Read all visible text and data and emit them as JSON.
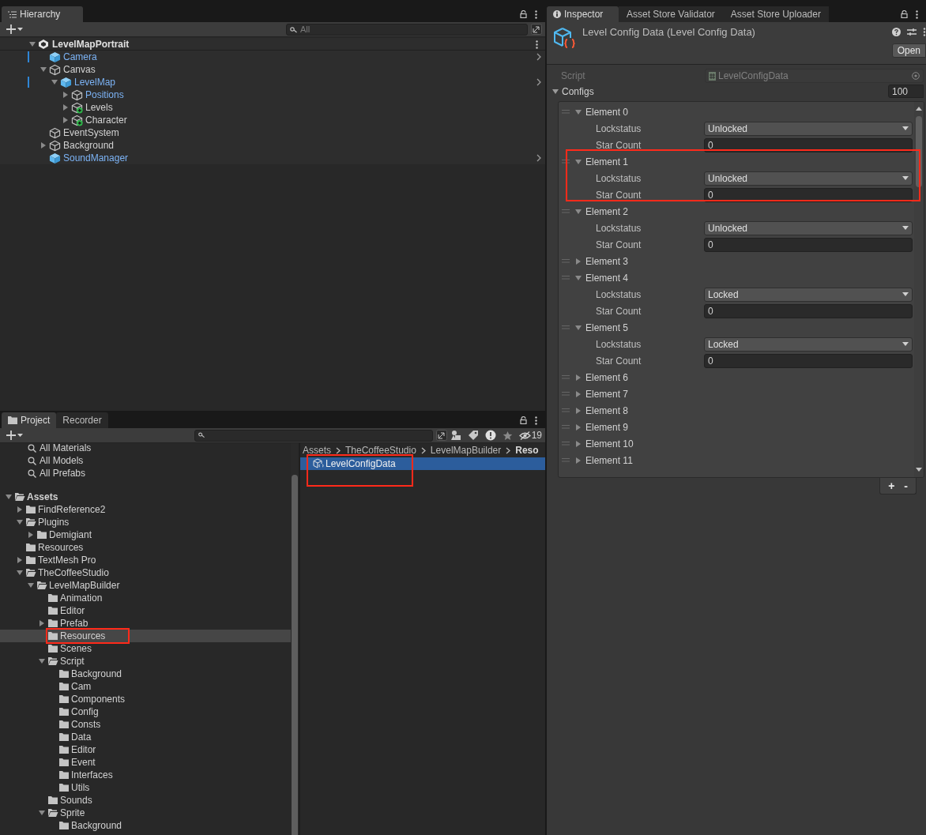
{
  "hierarchy": {
    "tab": {
      "label": "Hierarchy",
      "selected": true
    },
    "search": {
      "placeholder": "All"
    },
    "scene": {
      "name": "LevelMapPortrait",
      "expanded": true,
      "children": [
        {
          "name": "Camera",
          "kind": "prefab",
          "modified": true,
          "prefab_arrow": true
        },
        {
          "name": "Canvas",
          "kind": "object",
          "expanded": true,
          "children": [
            {
              "name": "LevelMap",
              "kind": "prefab",
              "modified": true,
              "prefab_arrow": true,
              "expanded": true,
              "children": [
                {
                  "name": "Positions",
                  "kind": "object",
                  "linked": true,
                  "expanded": false
                },
                {
                  "name": "Levels",
                  "kind": "added",
                  "expanded": false
                },
                {
                  "name": "Character",
                  "kind": "added",
                  "expanded": false
                }
              ]
            }
          ]
        },
        {
          "name": "EventSystem",
          "kind": "object"
        },
        {
          "name": "Background",
          "kind": "object",
          "expanded": false
        },
        {
          "name": "SoundManager",
          "kind": "prefab",
          "prefab_arrow": true
        }
      ]
    }
  },
  "project": {
    "tabs": [
      {
        "label": "Project",
        "selected": true
      },
      {
        "label": "Recorder",
        "selected": false
      }
    ],
    "hidden_count": "19",
    "favorites": [
      "All Materials",
      "All Models",
      "All Prefabs"
    ],
    "tree": {
      "name": "Assets",
      "expanded": true,
      "selected": false,
      "children": [
        {
          "name": "FindReference2",
          "expanded": false,
          "selected": false
        },
        {
          "name": "Plugins",
          "expanded": true,
          "selected": false,
          "children": [
            {
              "name": "Demigiant",
              "expanded": false,
              "selected": false
            }
          ]
        },
        {
          "name": "Resources",
          "selected": false
        },
        {
          "name": "TextMesh Pro",
          "expanded": false,
          "selected": false
        },
        {
          "name": "TheCoffeeStudio",
          "expanded": true,
          "selected": false,
          "children": [
            {
              "name": "LevelMapBuilder",
              "expanded": true,
              "selected": false,
              "children": [
                {
                  "name": "Animation",
                  "selected": false
                },
                {
                  "name": "Editor",
                  "selected": false
                },
                {
                  "name": "Prefab",
                  "expanded": false,
                  "selected": false
                },
                {
                  "name": "Resources",
                  "selected": true,
                  "highlighted": true
                },
                {
                  "name": "Scenes",
                  "selected": false
                },
                {
                  "name": "Script",
                  "expanded": true,
                  "selected": false,
                  "children": [
                    {
                      "name": "Background",
                      "selected": false
                    },
                    {
                      "name": "Cam",
                      "selected": false
                    },
                    {
                      "name": "Components",
                      "selected": false
                    },
                    {
                      "name": "Config",
                      "selected": false
                    },
                    {
                      "name": "Consts",
                      "selected": false
                    },
                    {
                      "name": "Data",
                      "selected": false
                    },
                    {
                      "name": "Editor",
                      "selected": false
                    },
                    {
                      "name": "Event",
                      "selected": false
                    },
                    {
                      "name": "Interfaces",
                      "selected": false
                    },
                    {
                      "name": "Utils",
                      "selected": false
                    }
                  ]
                },
                {
                  "name": "Sounds",
                  "selected": false
                },
                {
                  "name": "Sprite",
                  "expanded": true,
                  "selected": false,
                  "children": [
                    {
                      "name": "Background",
                      "selected": false
                    }
                  ]
                }
              ]
            }
          ]
        }
      ]
    },
    "breadcrumb": [
      "Assets",
      "TheCoffeeStudio",
      "LevelMapBuilder",
      "Reso"
    ],
    "files": [
      {
        "name": "LevelConfigData",
        "selected": true,
        "highlighted": true
      }
    ]
  },
  "inspector": {
    "tabs": [
      {
        "label": "Inspector",
        "selected": true
      },
      {
        "label": "Asset Store Validator",
        "selected": false
      },
      {
        "label": "Asset Store Uploader",
        "selected": false
      }
    ],
    "title": "Level Config Data (Level Config Data)",
    "open_button": "Open",
    "script_label": "Script",
    "script_value": "LevelConfigData",
    "list_label": "Configs",
    "list_size": "100",
    "elements": [
      {
        "label": "Element 0",
        "expanded": true,
        "highlighted": false,
        "fields": [
          {
            "label": "Lockstatus",
            "kind": "dropdown",
            "value": "Unlocked"
          },
          {
            "label": "Star Count",
            "kind": "number",
            "value": "0"
          }
        ]
      },
      {
        "label": "Element 1",
        "expanded": true,
        "highlighted": true,
        "fields": [
          {
            "label": "Lockstatus",
            "kind": "dropdown",
            "value": "Unlocked"
          },
          {
            "label": "Star Count",
            "kind": "number",
            "value": "0"
          }
        ]
      },
      {
        "label": "Element 2",
        "expanded": true,
        "highlighted": false,
        "fields": [
          {
            "label": "Lockstatus",
            "kind": "dropdown",
            "value": "Unlocked"
          },
          {
            "label": "Star Count",
            "kind": "number",
            "value": "0"
          }
        ]
      },
      {
        "label": "Element 3",
        "expanded": false,
        "highlighted": false
      },
      {
        "label": "Element 4",
        "expanded": true,
        "highlighted": false,
        "fields": [
          {
            "label": "Lockstatus",
            "kind": "dropdown",
            "value": "Locked"
          },
          {
            "label": "Star Count",
            "kind": "number",
            "value": "0"
          }
        ]
      },
      {
        "label": "Element 5",
        "expanded": true,
        "highlighted": false,
        "fields": [
          {
            "label": "Lockstatus",
            "kind": "dropdown",
            "value": "Locked"
          },
          {
            "label": "Star Count",
            "kind": "number",
            "value": "0"
          }
        ]
      },
      {
        "label": "Element 6",
        "expanded": false,
        "highlighted": false
      },
      {
        "label": "Element 7",
        "expanded": false,
        "highlighted": false
      },
      {
        "label": "Element 8",
        "expanded": false,
        "highlighted": false
      },
      {
        "label": "Element 9",
        "expanded": false,
        "highlighted": false
      },
      {
        "label": "Element 10",
        "expanded": false,
        "highlighted": false
      },
      {
        "label": "Element 11",
        "expanded": false,
        "highlighted": false
      }
    ],
    "add_button": "+",
    "remove_button": "-"
  }
}
